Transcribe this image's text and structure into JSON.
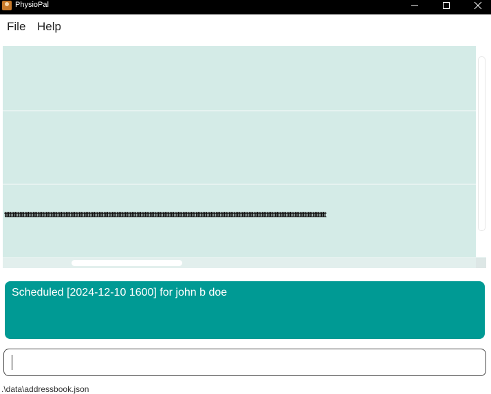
{
  "window": {
    "title": "PhysioPal",
    "icon": "app-icon"
  },
  "menu": {
    "items": [
      {
        "label": "File"
      },
      {
        "label": "Help"
      }
    ]
  },
  "list": {
    "rows": [
      {
        "text": ""
      },
      {
        "text": ""
      },
      {
        "text": "ttttttttttttttttttttttttttttttttttttttttttttttttttttttttttttttttttttttttttttttttttttttttttttttttttttttttttttttttttttttttttttttttttttttttttttttttttttttttttttttttttttttttttttttttttttttttttttttttttt"
      }
    ]
  },
  "result": {
    "text": "Scheduled [2024-12-10 1600] for john b doe"
  },
  "command": {
    "value": ""
  },
  "status": {
    "path": ".\\data\\addressbook.json"
  },
  "colors": {
    "titlebar": "#000000",
    "list_row": "#d4ebe7",
    "result_box": "#009a94"
  }
}
